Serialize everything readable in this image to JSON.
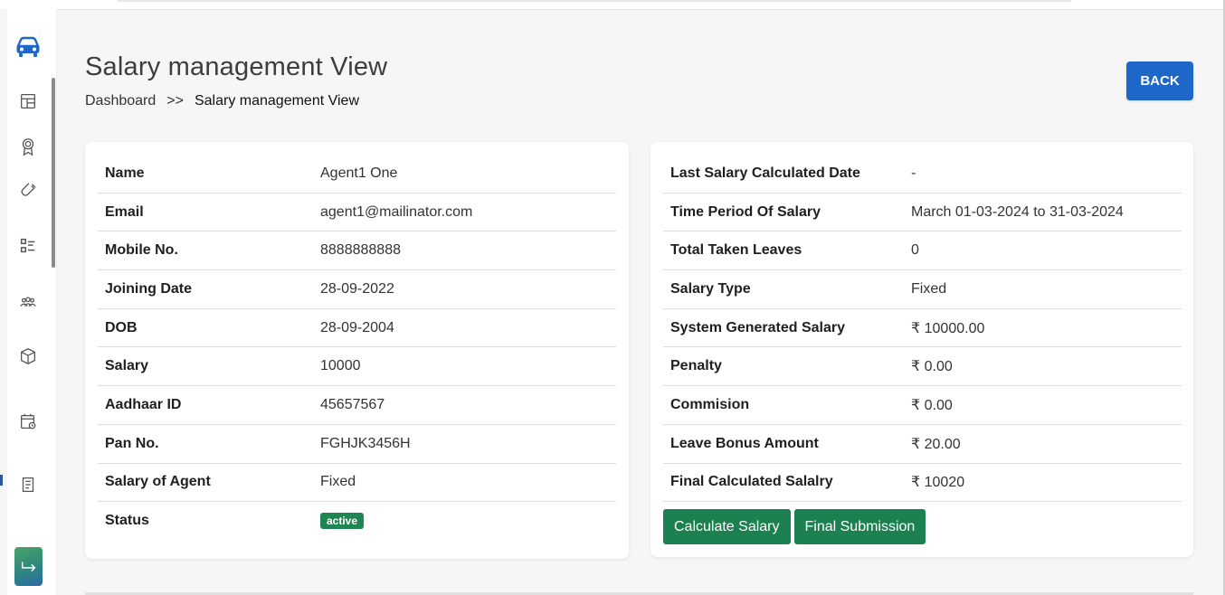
{
  "header": {
    "title": "Salary management View",
    "breadcrumb": {
      "home": "Dashboard",
      "separator": ">>",
      "current": "Salary management View"
    },
    "back_label": "BACK"
  },
  "sidebar": {
    "items": [
      {
        "name": "car-logo-icon"
      },
      {
        "name": "dashboard-icon"
      },
      {
        "name": "award-icon"
      },
      {
        "name": "magnet-icon"
      },
      {
        "name": "checklist-icon"
      },
      {
        "name": "team-icon"
      },
      {
        "name": "package-icon"
      },
      {
        "name": "calendar-icon"
      },
      {
        "name": "document-icon"
      },
      {
        "name": "logout-icon"
      }
    ]
  },
  "agent": {
    "rows": [
      {
        "label": "Name",
        "value": "Agent1 One"
      },
      {
        "label": "Email",
        "value": "agent1@mailinator.com"
      },
      {
        "label": "Mobile No.",
        "value": "8888888888"
      },
      {
        "label": "Joining Date",
        "value": "28-09-2022"
      },
      {
        "label": "DOB",
        "value": "28-09-2004"
      },
      {
        "label": "Salary",
        "value": "10000"
      },
      {
        "label": "Aadhaar ID",
        "value": "45657567"
      },
      {
        "label": "Pan No.",
        "value": "FGHJK3456H"
      },
      {
        "label": "Salary of Agent",
        "value": "Fixed"
      },
      {
        "label": "Status",
        "value": "active"
      }
    ]
  },
  "salary": {
    "rows": [
      {
        "label": "Last Salary Calculated Date",
        "value": "-"
      },
      {
        "label": "Time Period Of Salary",
        "value": "March 01-03-2024 to 31-03-2024"
      },
      {
        "label": "Total Taken Leaves",
        "value": "0"
      },
      {
        "label": "Salary Type",
        "value": "Fixed"
      },
      {
        "label": "System Generated Salary",
        "value": "₹ 10000.00"
      },
      {
        "label": "Penalty",
        "value": "₹ 0.00"
      },
      {
        "label": "Commision",
        "value": "₹ 0.00"
      },
      {
        "label": "Leave Bonus Amount",
        "value": "₹ 20.00"
      },
      {
        "label": "Final Calculated Salalry",
        "value": "₹ 10020"
      }
    ],
    "calculate_label": "Calculate Salary",
    "submit_label": "Final Submission"
  },
  "colors": {
    "primary": "#1e67c8",
    "success": "#1c8050",
    "badge": "#1f8553"
  }
}
